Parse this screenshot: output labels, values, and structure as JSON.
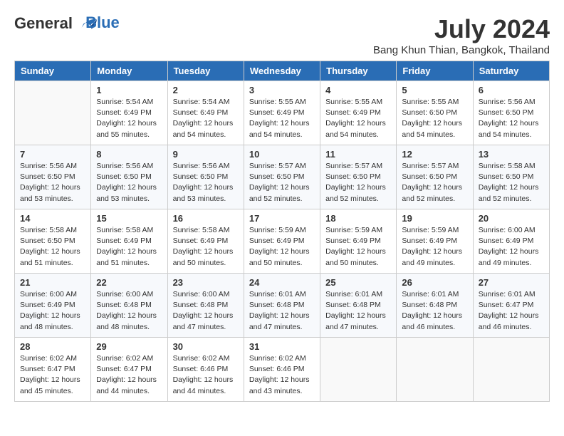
{
  "header": {
    "logo_line1": "General",
    "logo_line2": "Blue",
    "month_year": "July 2024",
    "location": "Bang Khun Thian, Bangkok, Thailand"
  },
  "weekdays": [
    "Sunday",
    "Monday",
    "Tuesday",
    "Wednesday",
    "Thursday",
    "Friday",
    "Saturday"
  ],
  "weeks": [
    [
      {
        "day": "",
        "detail": ""
      },
      {
        "day": "1",
        "detail": "Sunrise: 5:54 AM\nSunset: 6:49 PM\nDaylight: 12 hours\nand 55 minutes."
      },
      {
        "day": "2",
        "detail": "Sunrise: 5:54 AM\nSunset: 6:49 PM\nDaylight: 12 hours\nand 54 minutes."
      },
      {
        "day": "3",
        "detail": "Sunrise: 5:55 AM\nSunset: 6:49 PM\nDaylight: 12 hours\nand 54 minutes."
      },
      {
        "day": "4",
        "detail": "Sunrise: 5:55 AM\nSunset: 6:49 PM\nDaylight: 12 hours\nand 54 minutes."
      },
      {
        "day": "5",
        "detail": "Sunrise: 5:55 AM\nSunset: 6:50 PM\nDaylight: 12 hours\nand 54 minutes."
      },
      {
        "day": "6",
        "detail": "Sunrise: 5:56 AM\nSunset: 6:50 PM\nDaylight: 12 hours\nand 54 minutes."
      }
    ],
    [
      {
        "day": "7",
        "detail": "Sunrise: 5:56 AM\nSunset: 6:50 PM\nDaylight: 12 hours\nand 53 minutes."
      },
      {
        "day": "8",
        "detail": "Sunrise: 5:56 AM\nSunset: 6:50 PM\nDaylight: 12 hours\nand 53 minutes."
      },
      {
        "day": "9",
        "detail": "Sunrise: 5:56 AM\nSunset: 6:50 PM\nDaylight: 12 hours\nand 53 minutes."
      },
      {
        "day": "10",
        "detail": "Sunrise: 5:57 AM\nSunset: 6:50 PM\nDaylight: 12 hours\nand 52 minutes."
      },
      {
        "day": "11",
        "detail": "Sunrise: 5:57 AM\nSunset: 6:50 PM\nDaylight: 12 hours\nand 52 minutes."
      },
      {
        "day": "12",
        "detail": "Sunrise: 5:57 AM\nSunset: 6:50 PM\nDaylight: 12 hours\nand 52 minutes."
      },
      {
        "day": "13",
        "detail": "Sunrise: 5:58 AM\nSunset: 6:50 PM\nDaylight: 12 hours\nand 52 minutes."
      }
    ],
    [
      {
        "day": "14",
        "detail": "Sunrise: 5:58 AM\nSunset: 6:50 PM\nDaylight: 12 hours\nand 51 minutes."
      },
      {
        "day": "15",
        "detail": "Sunrise: 5:58 AM\nSunset: 6:49 PM\nDaylight: 12 hours\nand 51 minutes."
      },
      {
        "day": "16",
        "detail": "Sunrise: 5:58 AM\nSunset: 6:49 PM\nDaylight: 12 hours\nand 50 minutes."
      },
      {
        "day": "17",
        "detail": "Sunrise: 5:59 AM\nSunset: 6:49 PM\nDaylight: 12 hours\nand 50 minutes."
      },
      {
        "day": "18",
        "detail": "Sunrise: 5:59 AM\nSunset: 6:49 PM\nDaylight: 12 hours\nand 50 minutes."
      },
      {
        "day": "19",
        "detail": "Sunrise: 5:59 AM\nSunset: 6:49 PM\nDaylight: 12 hours\nand 49 minutes."
      },
      {
        "day": "20",
        "detail": "Sunrise: 6:00 AM\nSunset: 6:49 PM\nDaylight: 12 hours\nand 49 minutes."
      }
    ],
    [
      {
        "day": "21",
        "detail": "Sunrise: 6:00 AM\nSunset: 6:49 PM\nDaylight: 12 hours\nand 48 minutes."
      },
      {
        "day": "22",
        "detail": "Sunrise: 6:00 AM\nSunset: 6:48 PM\nDaylight: 12 hours\nand 48 minutes."
      },
      {
        "day": "23",
        "detail": "Sunrise: 6:00 AM\nSunset: 6:48 PM\nDaylight: 12 hours\nand 47 minutes."
      },
      {
        "day": "24",
        "detail": "Sunrise: 6:01 AM\nSunset: 6:48 PM\nDaylight: 12 hours\nand 47 minutes."
      },
      {
        "day": "25",
        "detail": "Sunrise: 6:01 AM\nSunset: 6:48 PM\nDaylight: 12 hours\nand 47 minutes."
      },
      {
        "day": "26",
        "detail": "Sunrise: 6:01 AM\nSunset: 6:48 PM\nDaylight: 12 hours\nand 46 minutes."
      },
      {
        "day": "27",
        "detail": "Sunrise: 6:01 AM\nSunset: 6:47 PM\nDaylight: 12 hours\nand 46 minutes."
      }
    ],
    [
      {
        "day": "28",
        "detail": "Sunrise: 6:02 AM\nSunset: 6:47 PM\nDaylight: 12 hours\nand 45 minutes."
      },
      {
        "day": "29",
        "detail": "Sunrise: 6:02 AM\nSunset: 6:47 PM\nDaylight: 12 hours\nand 44 minutes."
      },
      {
        "day": "30",
        "detail": "Sunrise: 6:02 AM\nSunset: 6:46 PM\nDaylight: 12 hours\nand 44 minutes."
      },
      {
        "day": "31",
        "detail": "Sunrise: 6:02 AM\nSunset: 6:46 PM\nDaylight: 12 hours\nand 43 minutes."
      },
      {
        "day": "",
        "detail": ""
      },
      {
        "day": "",
        "detail": ""
      },
      {
        "day": "",
        "detail": ""
      }
    ]
  ]
}
